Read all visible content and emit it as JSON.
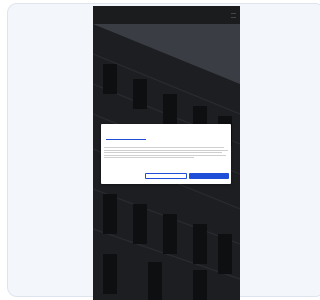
{
  "phone": {
    "header": {
      "logo_main": "",
      "logo_accent": ""
    }
  },
  "cookie_modal": {
    "tabs": [
      "",
      "",
      ""
    ],
    "brand": "",
    "heading": "",
    "buttons": {
      "allow_selection": "",
      "allow_all": ""
    }
  },
  "colors": {
    "accent": "#1f4fd6",
    "logo": "#c98a3a"
  }
}
